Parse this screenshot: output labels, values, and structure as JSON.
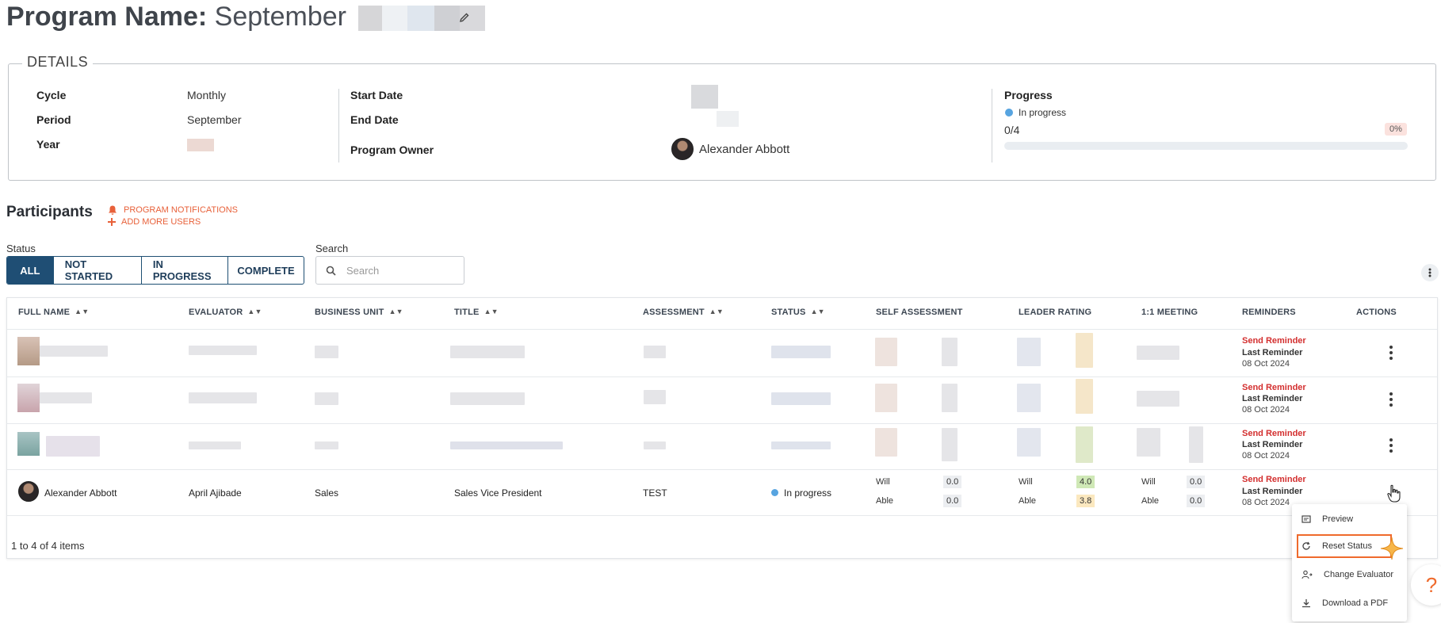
{
  "header": {
    "title_prefix": "Program Name:",
    "title_name": "September"
  },
  "details": {
    "legend": "DETAILS",
    "cycle_label": "Cycle",
    "cycle_value": "Monthly",
    "period_label": "Period",
    "period_value": "September",
    "year_label": "Year",
    "start_date_label": "Start Date",
    "end_date_label": "End Date",
    "owner_label": "Program Owner",
    "owner_name": "Alexander Abbott",
    "progress_label": "Progress",
    "progress_status": "In progress",
    "progress_count": "0/4",
    "progress_pct": "0%",
    "progress_fraction": 0
  },
  "participants": {
    "title": "Participants",
    "notifications_link": "PROGRAM NOTIFICATIONS",
    "add_users_link": "ADD MORE USERS",
    "status_label": "Status",
    "filters": [
      "ALL",
      "NOT STARTED",
      "IN PROGRESS",
      "COMPLETE"
    ],
    "search_label": "Search",
    "search_placeholder": "Search"
  },
  "table": {
    "headers": [
      "FULL NAME",
      "EVALUATOR",
      "BUSINESS UNIT",
      "TITLE",
      "ASSESSMENT",
      "STATUS",
      "SELF ASSESSMENT",
      "LEADER RATING",
      "1:1 MEETING",
      "REMINDERS",
      "ACTIONS"
    ],
    "reminder_action": "Send Reminder",
    "reminder_last": "Last Reminder",
    "reminder_date": "08 Oct 2024",
    "visible_row": {
      "name": "Alexander Abbott",
      "evaluator": "April Ajibade",
      "business_unit": "Sales",
      "title": "Sales Vice President",
      "assessment": "TEST",
      "status": "In progress",
      "will_label": "Will",
      "able_label": "Able",
      "self_will": "0.0",
      "self_able": "0.0",
      "leader_will": "4.0",
      "leader_able": "3.8",
      "meeting_will": "0.0",
      "meeting_able": "0.0"
    },
    "footer": "1 to 4 of 4 items"
  },
  "menu": {
    "items": [
      "Preview",
      "Reset Status",
      "Change Evaluator",
      "Download a PDF"
    ]
  },
  "help": "?",
  "colors": {
    "accent_orange": "#ef6a2c",
    "primary_navy": "#1f4e74",
    "reminder_red": "#d32f2f",
    "status_blue": "#57a4e0"
  }
}
